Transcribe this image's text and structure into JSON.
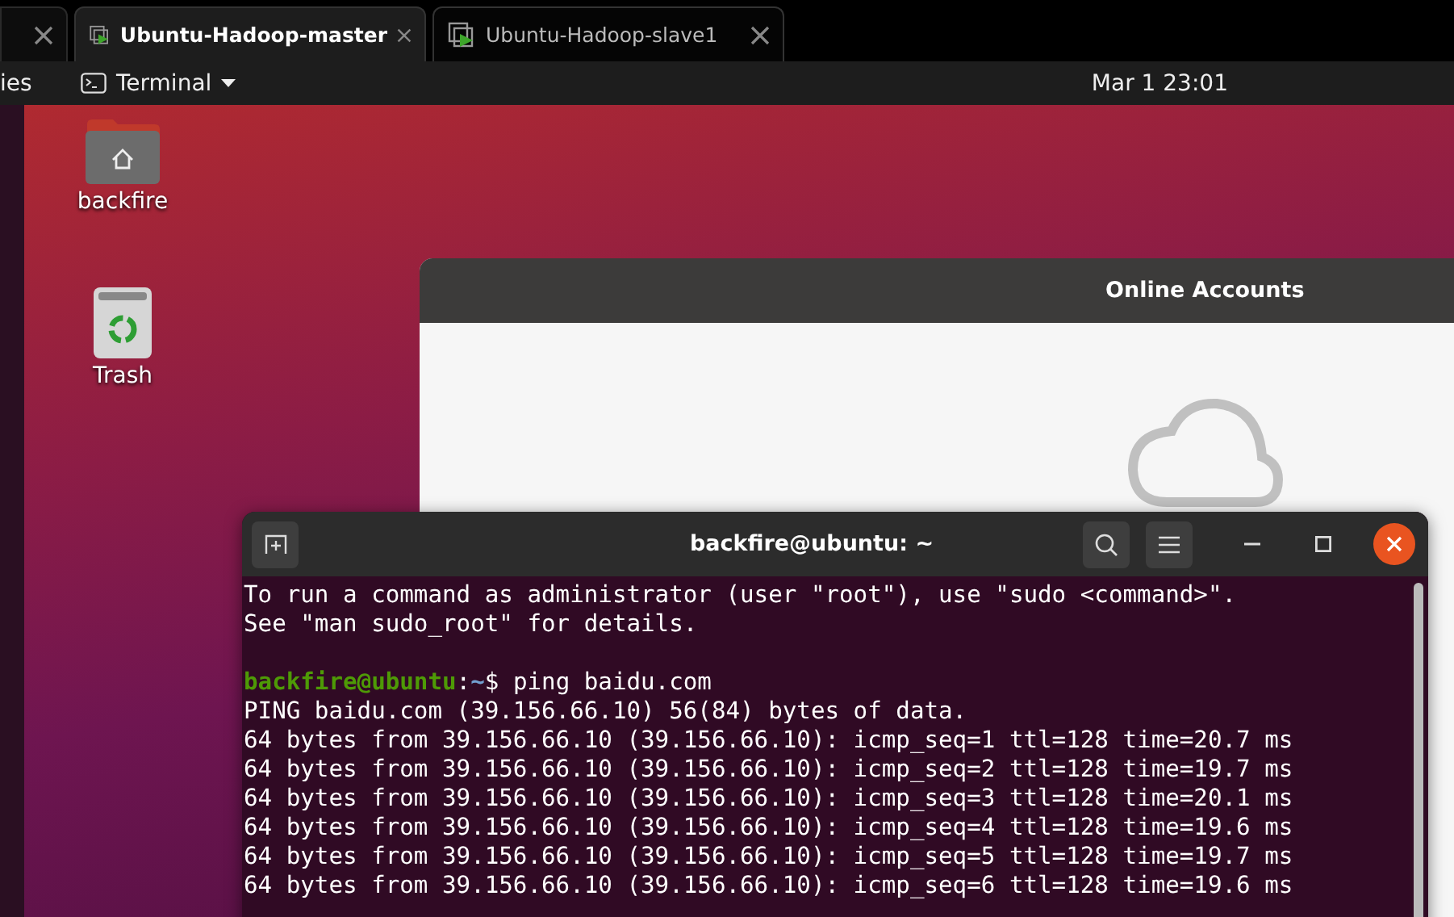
{
  "browser_tabs": [
    {
      "label": "Ubuntu-Hadoop-master",
      "selected": true
    },
    {
      "label": "Ubuntu-Hadoop-slave1",
      "selected": false
    }
  ],
  "top_bar": {
    "activities": "ies",
    "app_menu": "Terminal",
    "clock": "Mar 1  23:01"
  },
  "desktop_icons": [
    {
      "kind": "folder",
      "label": "backfire"
    },
    {
      "kind": "trash",
      "label": "Trash"
    }
  ],
  "online_accounts": {
    "title": "Online Accounts"
  },
  "terminal": {
    "title": "backfire@ubuntu: ~",
    "lines": [
      {
        "kind": "text",
        "text": "To run a command as administrator (user \"root\"), use \"sudo <command>\"."
      },
      {
        "kind": "text",
        "text": "See \"man sudo_root\" for details."
      },
      {
        "kind": "blank"
      },
      {
        "kind": "prompt",
        "user_host": "backfire@ubuntu",
        "sep": ":",
        "path": "~",
        "command": "$ ping baidu.com"
      },
      {
        "kind": "text",
        "text": "PING baidu.com (39.156.66.10) 56(84) bytes of data."
      },
      {
        "kind": "text",
        "text": "64 bytes from 39.156.66.10 (39.156.66.10): icmp_seq=1 ttl=128 time=20.7 ms"
      },
      {
        "kind": "text",
        "text": "64 bytes from 39.156.66.10 (39.156.66.10): icmp_seq=2 ttl=128 time=19.7 ms"
      },
      {
        "kind": "text",
        "text": "64 bytes from 39.156.66.10 (39.156.66.10): icmp_seq=3 ttl=128 time=20.1 ms"
      },
      {
        "kind": "text",
        "text": "64 bytes from 39.156.66.10 (39.156.66.10): icmp_seq=4 ttl=128 time=19.6 ms"
      },
      {
        "kind": "text",
        "text": "64 bytes from 39.156.66.10 (39.156.66.10): icmp_seq=5 ttl=128 time=19.7 ms"
      },
      {
        "kind": "text",
        "text": "64 bytes from 39.156.66.10 (39.156.66.10): icmp_seq=6 ttl=128 time=19.6 ms"
      }
    ]
  }
}
